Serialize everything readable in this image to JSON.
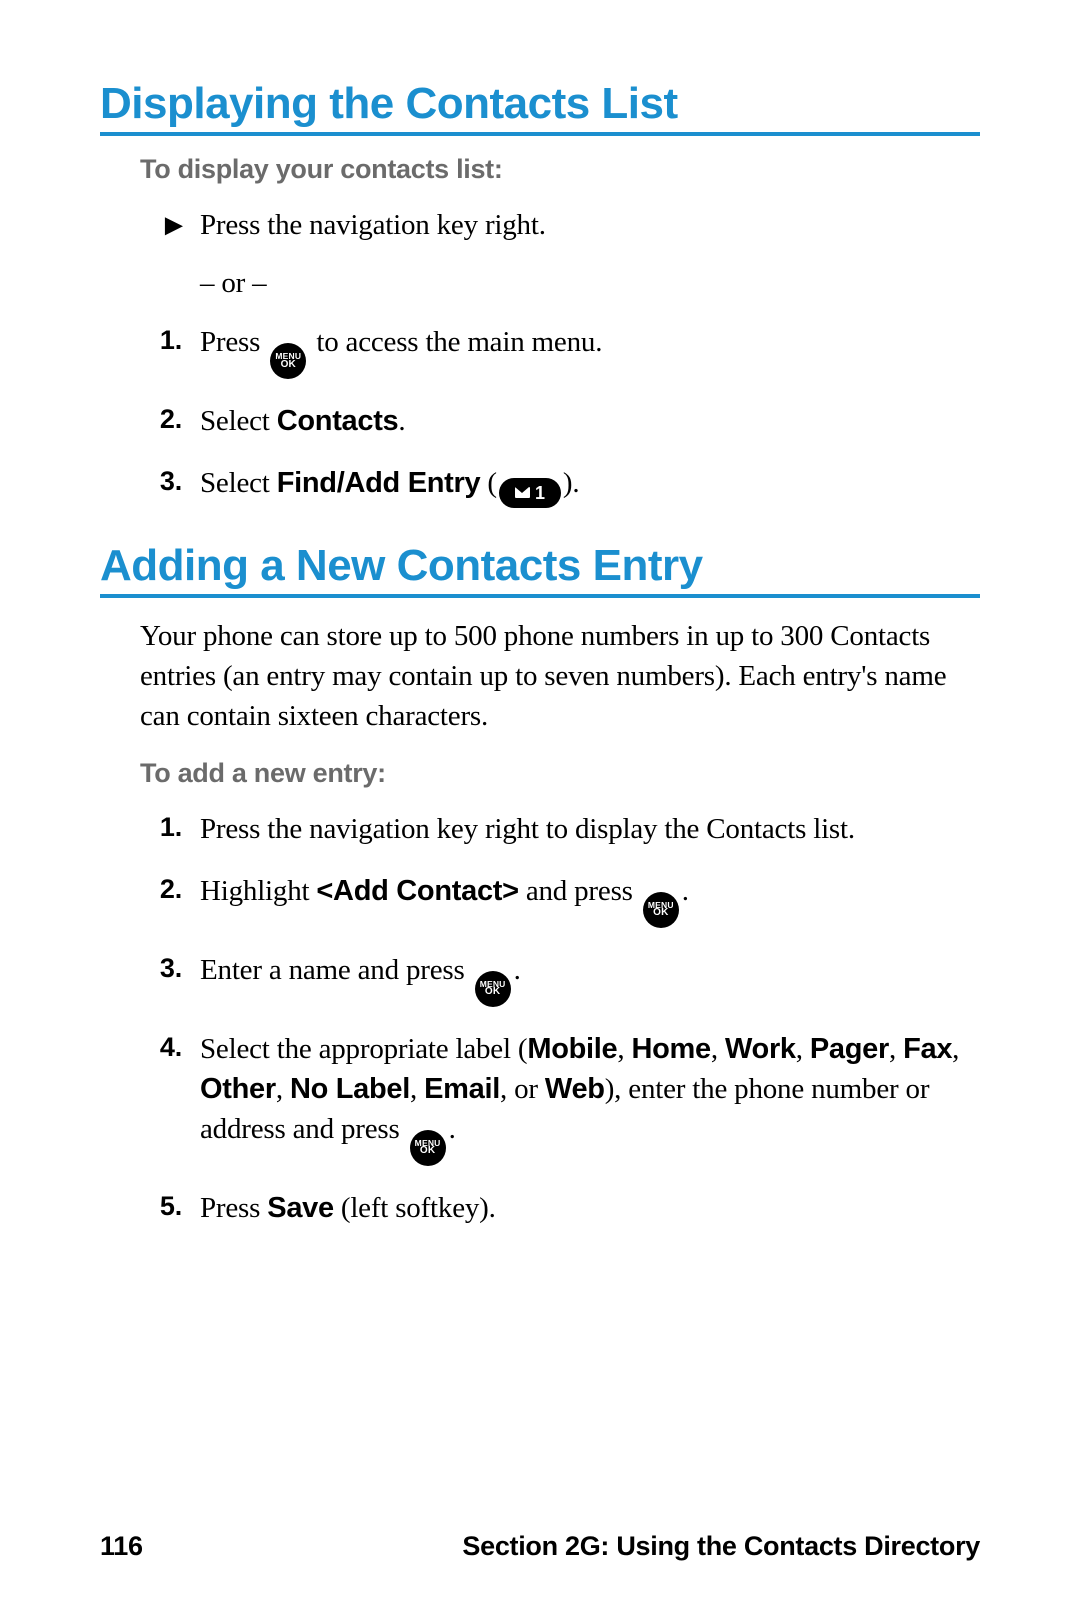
{
  "section1": {
    "heading": "Displaying the Contacts List",
    "subhead": "To display your contacts list:",
    "bullet_pre": "Press the navigation key right.",
    "or_line": "– or –",
    "steps": [
      {
        "num": "1.",
        "pre": "Press ",
        "post": " to access the main menu."
      },
      {
        "num": "2.",
        "pre": "Select ",
        "bold": "Contacts",
        "post": "."
      },
      {
        "num": "3.",
        "pre": "Select ",
        "bold": "Find/Add Entry",
        "post_open": " (",
        "post_close": ")."
      }
    ]
  },
  "section2": {
    "heading": "Adding a New Contacts Entry",
    "intro": "Your phone can store up to 500 phone numbers in up to 300 Contacts entries (an entry may contain up to seven numbers). Each entry's name can contain sixteen characters.",
    "subhead": "To add a new entry:",
    "steps": {
      "s1": {
        "num": "1.",
        "text": "Press the navigation key right to display the Contacts list."
      },
      "s2": {
        "num": "2.",
        "pre": "Highlight ",
        "bold": "<Add Contact>",
        "mid": " and press ",
        "post": "."
      },
      "s3": {
        "num": "3.",
        "pre": "Enter a name and press ",
        "post": "."
      },
      "s4": {
        "num": "4.",
        "pre": "Select the appropriate label (",
        "labels": [
          "Mobile",
          "Home",
          "Work",
          "Pager",
          "Fax",
          "Other",
          "No Label",
          "Email"
        ],
        "or_word": ", or ",
        "last_label": "Web",
        "mid": "), enter the phone number or address and press ",
        "post": "."
      },
      "s5": {
        "num": "5.",
        "pre": "Press ",
        "bold": "Save",
        "post": " (left softkey)."
      }
    }
  },
  "icons": {
    "menu_ok_top": "MENU",
    "menu_ok_bottom": "OK",
    "key1_digit": "1"
  },
  "footer": {
    "page": "116",
    "title": "Section 2G: Using the Contacts Directory"
  },
  "sep": ", "
}
